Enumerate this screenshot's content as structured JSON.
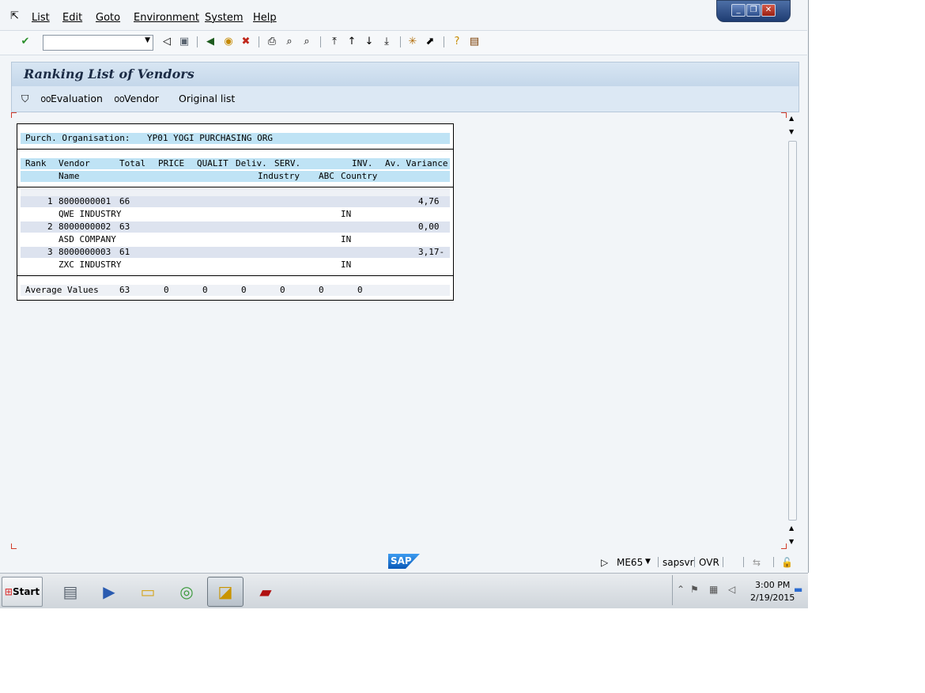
{
  "menubar": {
    "items": [
      {
        "label": "List"
      },
      {
        "label": "Edit"
      },
      {
        "label": "Goto"
      },
      {
        "label": "Environment"
      },
      {
        "label": "System"
      },
      {
        "label": "Help"
      }
    ]
  },
  "window_controls": {
    "minimize": "_",
    "restore": "❐",
    "close": "✕"
  },
  "toolbar": {
    "command_field_value": "",
    "icons": [
      "enter-icon",
      "back-icon",
      "save-icon",
      "green-back-icon",
      "exit-icon",
      "cancel-icon",
      "print-icon",
      "find-icon",
      "find-next-icon",
      "first-page-icon",
      "previous-page-icon",
      "next-page-icon",
      "last-page-icon",
      "new-session-icon",
      "shortcut-icon",
      "help-icon",
      "layout-icon"
    ]
  },
  "title": "Ranking List of Vendors",
  "app_toolbar": {
    "evaluation": "Evaluation",
    "vendor": "Vendor",
    "original_list": "Original list"
  },
  "report": {
    "org_label": "Purch. Organisation:",
    "org_value": "YP01 YOGI PURCHASING ORG",
    "header1": [
      "Rank",
      "Vendor",
      "Total",
      "PRICE",
      "QUALIT",
      "Deliv.",
      "SERV.",
      "INV.",
      "Av. Variance"
    ],
    "header2": [
      "Name",
      "Industry",
      "ABC",
      "Country"
    ],
    "rows": [
      {
        "rank": "1",
        "vendor": "8000000001",
        "total": "66",
        "variance": "4,76",
        "name": "QWE INDUSTRY",
        "country": "IN"
      },
      {
        "rank": "2",
        "vendor": "8000000002",
        "total": "63",
        "variance": "0,00",
        "name": "ASD COMPANY",
        "country": "IN"
      },
      {
        "rank": "3",
        "vendor": "8000000003",
        "total": "61",
        "variance": "3,17-",
        "name": "ZXC INDUSTRY",
        "country": "IN"
      }
    ],
    "average_label": "Average Values",
    "averages": [
      "63",
      "0",
      "0",
      "0",
      "0",
      "0",
      "0"
    ]
  },
  "statusbar": {
    "logo": "SAP",
    "transaction": "ME65",
    "server": "sapsvr",
    "mode": "OVR"
  },
  "taskbar": {
    "start": "Start",
    "apps": [
      "server-manager-icon",
      "powershell-icon",
      "explorer-icon",
      "chrome-icon",
      "sap-logon-icon",
      "acrobat-icon"
    ],
    "time": "3:00 PM",
    "date": "2/19/2015"
  },
  "colors": {
    "title_band": "#c4d7ea",
    "report_header_band": "#bfe3f5",
    "row_band": "#dde3ef"
  }
}
